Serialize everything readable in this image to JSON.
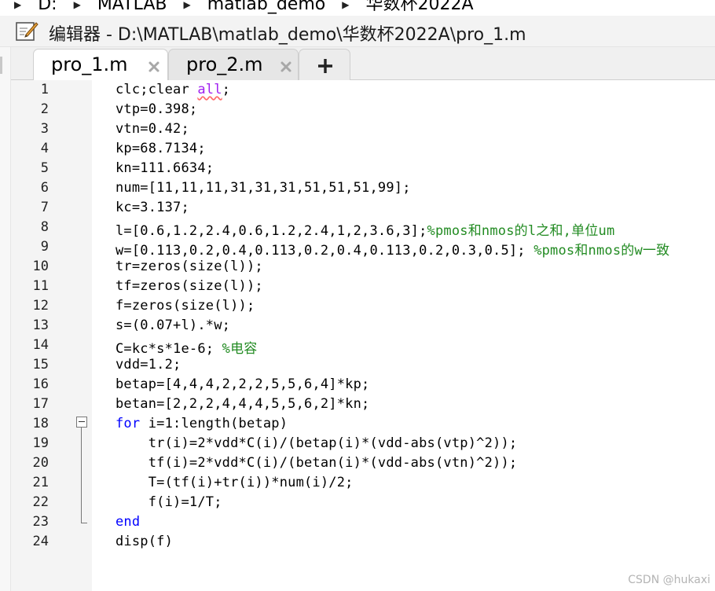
{
  "breadcrumb": {
    "items": [
      "D:",
      "MATLAB",
      "matlab_demo",
      "华数杯2022A"
    ]
  },
  "window": {
    "title": "编辑器 - D:\\MATLAB\\matlab_demo\\华数杯2022A\\pro_1.m"
  },
  "tabs": [
    {
      "label": "pro_1.m",
      "active": true
    },
    {
      "label": "pro_2.m",
      "active": false
    }
  ],
  "add_tab_symbol": "+",
  "lines": [
    {
      "n": "1",
      "segs": [
        {
          "t": "clc;clear ",
          "c": "code"
        },
        {
          "t": "all",
          "c": "str"
        },
        {
          "t": ";",
          "c": "code"
        }
      ]
    },
    {
      "n": "2",
      "segs": [
        {
          "t": "vtp=0.398;",
          "c": "code"
        }
      ]
    },
    {
      "n": "3",
      "segs": [
        {
          "t": "vtn=0.42;",
          "c": "code"
        }
      ]
    },
    {
      "n": "4",
      "segs": [
        {
          "t": "kp=68.7134;",
          "c": "code"
        }
      ]
    },
    {
      "n": "5",
      "segs": [
        {
          "t": "kn=111.6634;",
          "c": "code"
        }
      ]
    },
    {
      "n": "6",
      "segs": [
        {
          "t": "num=[11,11,11,31,31,31,51,51,51,99];",
          "c": "code"
        }
      ]
    },
    {
      "n": "7",
      "segs": [
        {
          "t": "kc=3.137;",
          "c": "code"
        }
      ]
    },
    {
      "n": "8",
      "segs": [
        {
          "t": "l=[0.6,1.2,2.4,0.6,1.2,2.4,1,2,3.6,3];",
          "c": "code"
        },
        {
          "t": "%pmos和nmos的l之和,单位um",
          "c": "cm"
        }
      ]
    },
    {
      "n": "9",
      "segs": [
        {
          "t": "w=[0.113,0.2,0.4,0.113,0.2,0.4,0.113,0.2,0.3,0.5]; ",
          "c": "code"
        },
        {
          "t": "%pmos和nmos的w一致",
          "c": "cm"
        }
      ]
    },
    {
      "n": "10",
      "segs": [
        {
          "t": "tr=zeros(size(l));",
          "c": "code"
        }
      ]
    },
    {
      "n": "11",
      "segs": [
        {
          "t": "tf=zeros(size(l));",
          "c": "code"
        }
      ]
    },
    {
      "n": "12",
      "segs": [
        {
          "t": "f=zeros(size(l));",
          "c": "code"
        }
      ]
    },
    {
      "n": "13",
      "segs": [
        {
          "t": "s=(0.07+l).*w;",
          "c": "code"
        }
      ]
    },
    {
      "n": "14",
      "segs": [
        {
          "t": "C=kc*s*1e-6; ",
          "c": "code"
        },
        {
          "t": "%电容",
          "c": "cm"
        }
      ]
    },
    {
      "n": "15",
      "segs": [
        {
          "t": "vdd=1.2;",
          "c": "code"
        }
      ]
    },
    {
      "n": "16",
      "segs": [
        {
          "t": "betap=[4,4,4,2,2,2,5,5,6,4]*kp;",
          "c": "code"
        }
      ]
    },
    {
      "n": "17",
      "segs": [
        {
          "t": "betan=[2,2,2,4,4,4,5,5,6,2]*kn;",
          "c": "code"
        }
      ]
    },
    {
      "n": "18",
      "segs": [
        {
          "t": "for",
          "c": "kw"
        },
        {
          "t": " i=1:length(betap)",
          "c": "code"
        }
      ]
    },
    {
      "n": "19",
      "segs": [
        {
          "t": "    tr(i)=2*vdd*C(i)/(betap(i)*(vdd-abs(vtp)^2));",
          "c": "code"
        }
      ]
    },
    {
      "n": "20",
      "segs": [
        {
          "t": "    tf(i)=2*vdd*C(i)/(betan(i)*(vdd-abs(vtn)^2));",
          "c": "code"
        }
      ]
    },
    {
      "n": "21",
      "segs": [
        {
          "t": "    T=(tf(i)+tr(i))*num(i)/2;",
          "c": "code"
        }
      ]
    },
    {
      "n": "22",
      "segs": [
        {
          "t": "    f(i)=1/T;",
          "c": "code"
        }
      ]
    },
    {
      "n": "23",
      "segs": [
        {
          "t": "end",
          "c": "kw"
        }
      ]
    },
    {
      "n": "24",
      "segs": [
        {
          "t": "disp(f)",
          "c": "code"
        }
      ]
    }
  ],
  "watermark": "CSDN @hukaxi",
  "colors": {
    "keyword": "#0000ff",
    "string": "#a020f0",
    "comment": "#228b22"
  }
}
